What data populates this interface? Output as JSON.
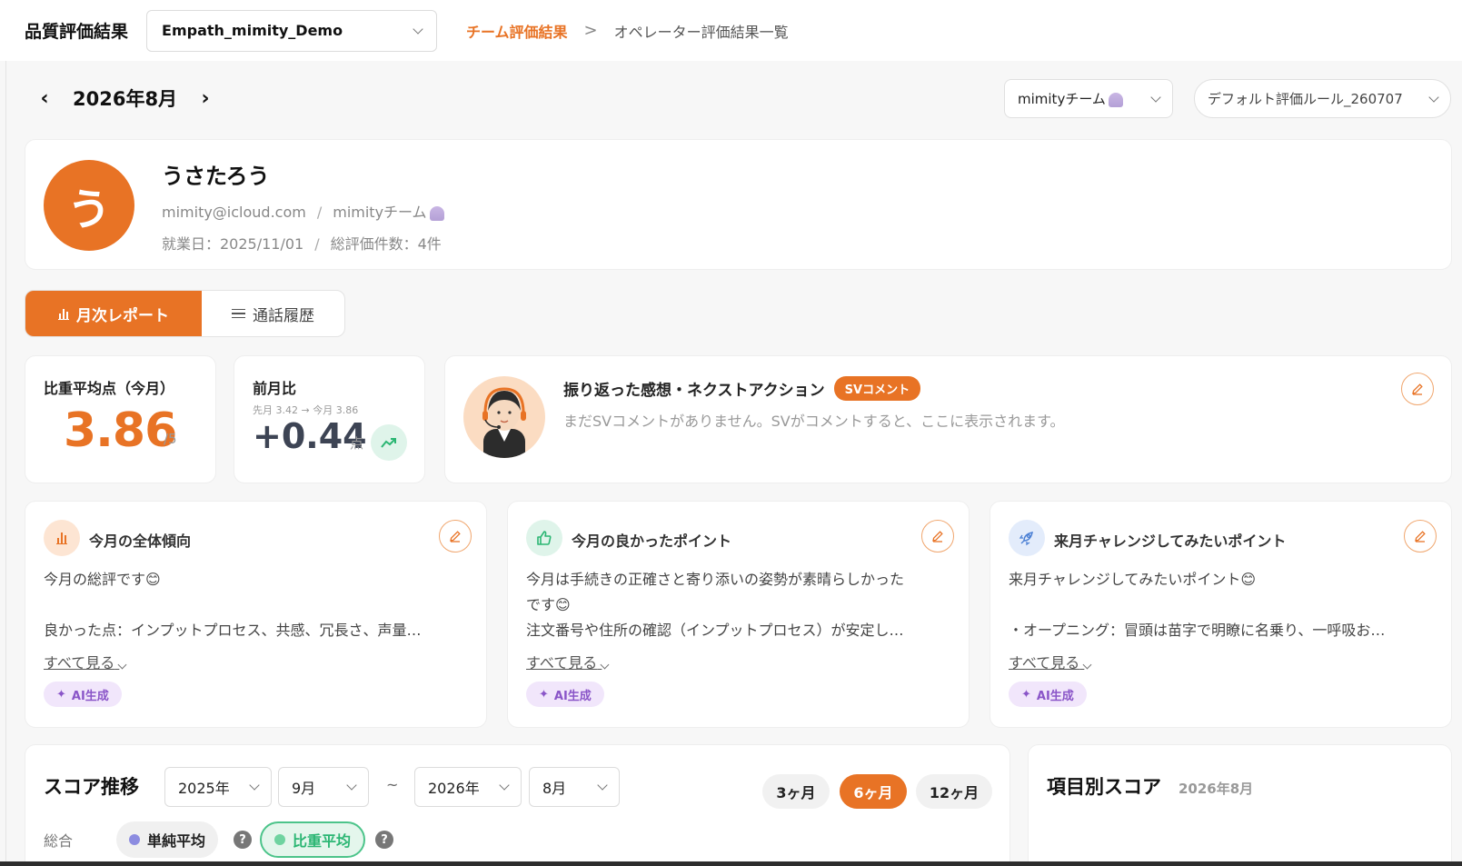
{
  "header": {
    "app_title": "品質評価結果",
    "project": "Empath_mimity_Demo",
    "breadcrumb_active": "チーム評価結果",
    "breadcrumb_separator": ">",
    "breadcrumb_current": "オペレーター評価結果一覧"
  },
  "month_nav": {
    "prev": "‹",
    "label": "2026年8月",
    "next": "›"
  },
  "filters": {
    "team": "mimityチーム",
    "rule": "デフォルト評価ルール_260707"
  },
  "profile": {
    "avatar_initial": "う",
    "name": "うさたろう",
    "email": "mimity@icloud.com",
    "team": "mimityチーム",
    "separator": "/",
    "start_date": "就業日：2025/11/01",
    "eval_count": "総評価件数：4件"
  },
  "tabs": {
    "monthly": "月次レポート",
    "history": "通話履歴"
  },
  "scores": {
    "avg_label": "比重平均点（今月）",
    "avg_value": "3.86",
    "avg_unit": "/5",
    "diff_label": "前月比",
    "diff_sub": "先月 3.42 → 今月 3.86",
    "diff_value": "+0.44",
    "diff_unit": "点"
  },
  "reflection": {
    "title": "振り返った感想・ネクストアクション",
    "badge": "SVコメント",
    "empty": "まだSVコメントがありません。SVがコメントすると、ここに表示されます。"
  },
  "points": [
    {
      "title": "今月の全体傾向",
      "line1": "今月の総評です😊",
      "line2": "",
      "line3": "良かった点：インプットプロセス、共感、冗長さ、声量…",
      "see_all": "すべて見る",
      "ai": "AI生成"
    },
    {
      "title": "今月の良かったポイント",
      "line1": "今月は手続きの正確さと寄り添いの姿勢が素晴らしかった",
      "line2": "です😊",
      "line3": "注文番号や住所の確認（インプットプロセス）が安定し…",
      "see_all": "すべて見る",
      "ai": "AI生成"
    },
    {
      "title": "来月チャレンジしてみたいポイント",
      "line1": "来月チャレンジしてみたいポイント😊",
      "line2": "",
      "line3": "・オープニング：冒頭は苗字で明瞭に名乗り、一呼吸お…",
      "see_all": "すべて見る",
      "ai": "AI生成"
    }
  ],
  "trend": {
    "title": "スコア推移",
    "from_year": "2025年",
    "from_month": "9月",
    "tilde": "~",
    "to_year": "2026年",
    "to_month": "8月",
    "ranges": [
      "3ヶ月",
      "6ヶ月",
      "12ヶ月"
    ],
    "active_range": "6ヶ月",
    "row_label": "総合",
    "simple_avg": "単純平均",
    "weighted_avg": "比重平均",
    "help": "?"
  },
  "items": {
    "title": "項目別スコア",
    "month": "2026年8月"
  },
  "colors": {
    "accent": "#e87325",
    "green": "#2bb673",
    "purple": "#8a55c8"
  }
}
